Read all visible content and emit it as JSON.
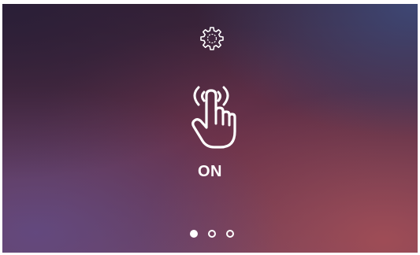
{
  "screen": {
    "settings_icon": "gear-icon",
    "gesture_icon": "tap-hand-icon",
    "status_text": "ON",
    "page_indicator": {
      "total": 3,
      "current": 1
    },
    "colors": {
      "foreground": "#ffffff",
      "background_top": "#3a2236",
      "background_bottom": "#6e3f5a"
    }
  }
}
